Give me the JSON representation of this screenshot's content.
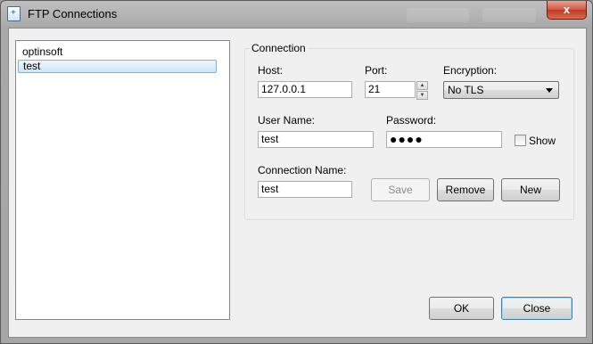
{
  "window": {
    "title": "FTP Connections",
    "close_glyph": "x",
    "app_icon": "ftp-app-icon"
  },
  "connections": [
    {
      "label": "optinsoft",
      "selected": false
    },
    {
      "label": "test",
      "selected": true
    }
  ],
  "group": {
    "title": "Connection"
  },
  "form": {
    "host_label": "Host:",
    "host_value": "127.0.0.1",
    "port_label": "Port:",
    "port_value": "21",
    "encryption_label": "Encryption:",
    "encryption_value": "No TLS",
    "username_label": "User Name:",
    "username_value": "test",
    "password_label": "Password:",
    "password_value": "●●●●",
    "show_label": "Show",
    "show_checked": false,
    "connection_name_label": "Connection Name:",
    "connection_name_value": "test"
  },
  "buttons": {
    "save": "Save",
    "remove": "Remove",
    "new": "New",
    "ok": "OK",
    "close": "Close"
  }
}
